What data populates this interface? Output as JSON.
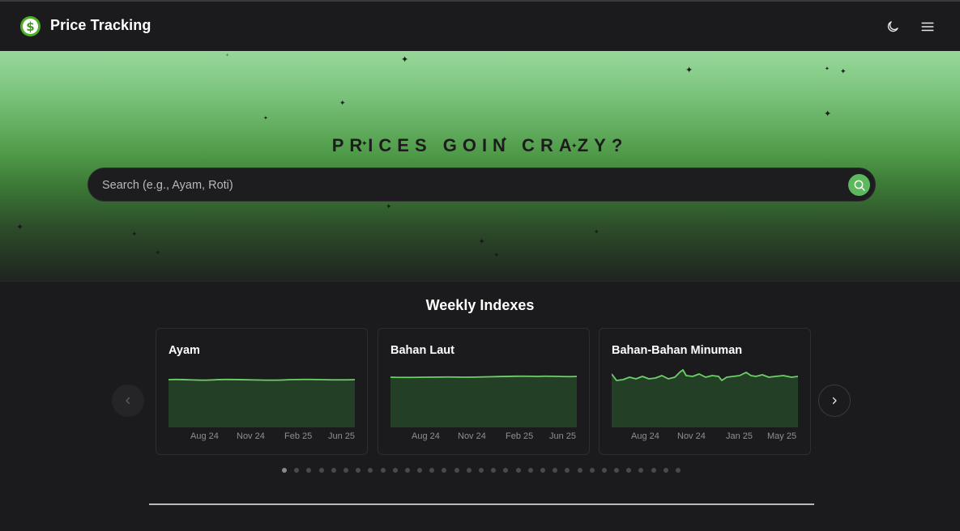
{
  "header": {
    "logo_glyph": "$",
    "brand": "Price Tracking",
    "icons": [
      "moon-icon",
      "hamburger-menu-icon"
    ]
  },
  "hero": {
    "title": "PRICES GOIN CRAZY?",
    "search": {
      "placeholder": "Search (e.g., Ayam, Roti)",
      "value": ""
    },
    "accent": "#5cb85c"
  },
  "indexes": {
    "title": "Weekly Indexes",
    "cards": [
      {
        "title": "Ayam",
        "ticks": [
          "Aug 24",
          "Nov 24",
          "Feb 25",
          "Jun 25"
        ]
      },
      {
        "title": "Bahan Laut",
        "ticks": [
          "Aug 24",
          "Nov 24",
          "Feb 25",
          "Jun 25"
        ]
      },
      {
        "title": "Bahan-Bahan Minuman",
        "ticks": [
          "Aug 24",
          "Nov 24",
          "Jan 25",
          "May 25"
        ]
      }
    ],
    "carousel": {
      "dot_count": 33,
      "active_dot": 1
    }
  },
  "colors": {
    "line": "#6dcf6a",
    "area": "#234026",
    "background": "#1b1b1d"
  }
}
